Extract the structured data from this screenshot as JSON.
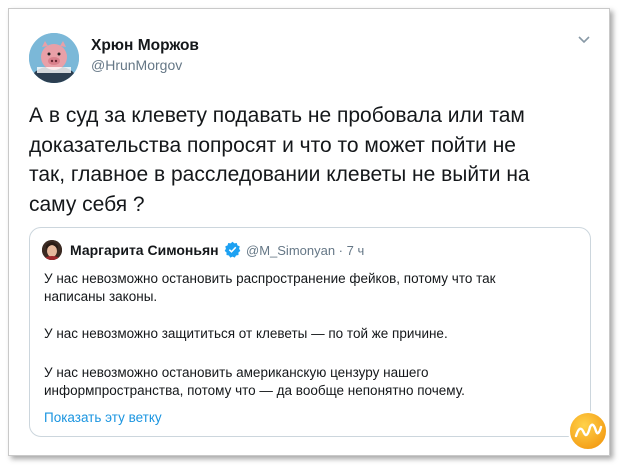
{
  "tweet": {
    "author_name": "Хрюн Моржов",
    "author_handle": "@HrunMorgov",
    "text_lines": [
      "А в  суд за клевету подавать не пробовала или там",
      "доказательства попросят и что то может пойти не",
      "так, главное в расследовании клеветы не выйти на",
      "саму себя ?"
    ]
  },
  "quote": {
    "author_name": "Маргарита Симоньян",
    "handle_time": "@M_Simonyan · 7 ч",
    "lines": [
      "У нас невозможно остановить распространение фейков, потому что так",
      "написаны законы.",
      "У нас невозможно защититься от клеветы — по той же причине.",
      "У нас невозможно остановить американскую цензуру нашего",
      "информпространства, потому что — да вообще непонятно почему."
    ],
    "show_thread": "Показать эту ветку"
  },
  "icons": {
    "menu": "chevron-down-icon",
    "verified": "verified-badge-icon"
  },
  "colors": {
    "link": "#1b95e0",
    "muted": "#657786",
    "text": "#14171a",
    "verified": "#1da1f2"
  }
}
